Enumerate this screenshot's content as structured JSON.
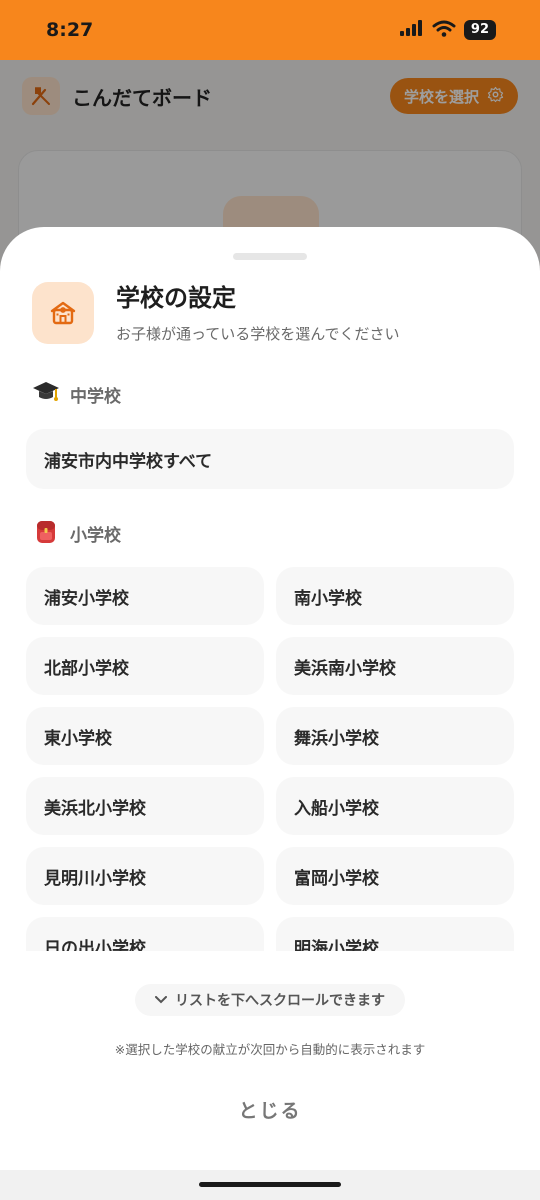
{
  "status_bar": {
    "time": "8:27",
    "battery": "92"
  },
  "app": {
    "title": "こんだてボード",
    "select_button": "学校を選択"
  },
  "sheet": {
    "title": "学校の設定",
    "subtitle": "お子様が通っている学校を選んでください",
    "junior_high": {
      "label": "中学校",
      "options": [
        "浦安市内中学校すべて"
      ]
    },
    "elementary": {
      "label": "小学校",
      "options": [
        "浦安小学校",
        "南小学校",
        "北部小学校",
        "美浜南小学校",
        "東小学校",
        "舞浜小学校",
        "美浜北小学校",
        "入船小学校",
        "見明川小学校",
        "富岡小学校",
        "日の出小学校",
        "明海小学校"
      ]
    },
    "scroll_hint": "リストを下へスクロールできます",
    "note": "※選択した学校の献立が次回から自動的に表示されます",
    "close": "とじる"
  },
  "colors": {
    "accent": "#f7861c",
    "accent_soft": "#fde3cc"
  },
  "icons": {
    "brand": "fork-knife-icon",
    "select": "gear-icon",
    "school": "school-building-icon",
    "junior_high": "graduation-cap-icon",
    "elementary": "school-backpack-icon",
    "hint": "chevron-down-icon"
  }
}
